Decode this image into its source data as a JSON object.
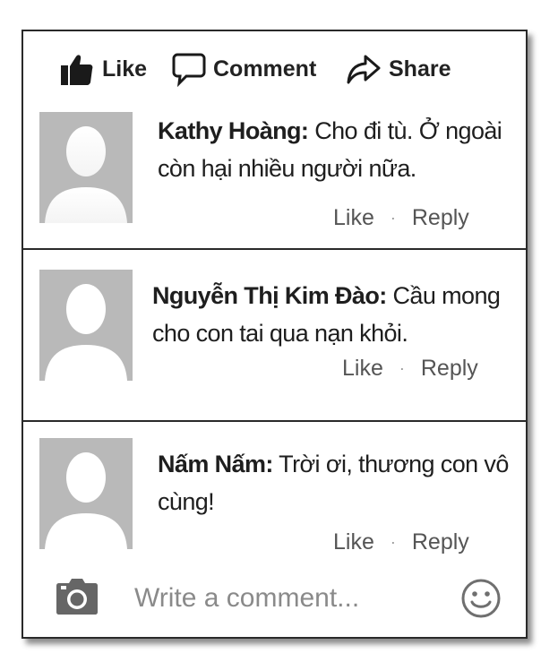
{
  "actions": {
    "like_label": "Like",
    "comment_label": "Comment",
    "share_label": "Share"
  },
  "comments": [
    {
      "author": "Kathy Hoàng:",
      "text": "Cho đi tù. Ở ngoài còn hại nhiều người nữa.",
      "like_label": "Like",
      "separator": "·",
      "reply_label": "Reply"
    },
    {
      "author": "Nguyễn Thị Kim Đào:",
      "text": "Cầu mong cho con tai qua nạn khỏi.",
      "like_label": "Like",
      "separator": "·",
      "reply_label": "Reply"
    },
    {
      "author": "Nấm Nấm:",
      "text": "Trời ơi, thương con vô cùng!",
      "like_label": "Like",
      "separator": "·",
      "reply_label": "Reply"
    }
  ],
  "composer": {
    "placeholder": "Write a comment...",
    "camera_icon": "camera-icon",
    "emoji_icon": "smiley-icon"
  },
  "colors": {
    "border": "#2a2a2a",
    "avatar_bg": "#b9b9b9",
    "meta_text": "#555555",
    "placeholder": "#8a8a8a"
  }
}
